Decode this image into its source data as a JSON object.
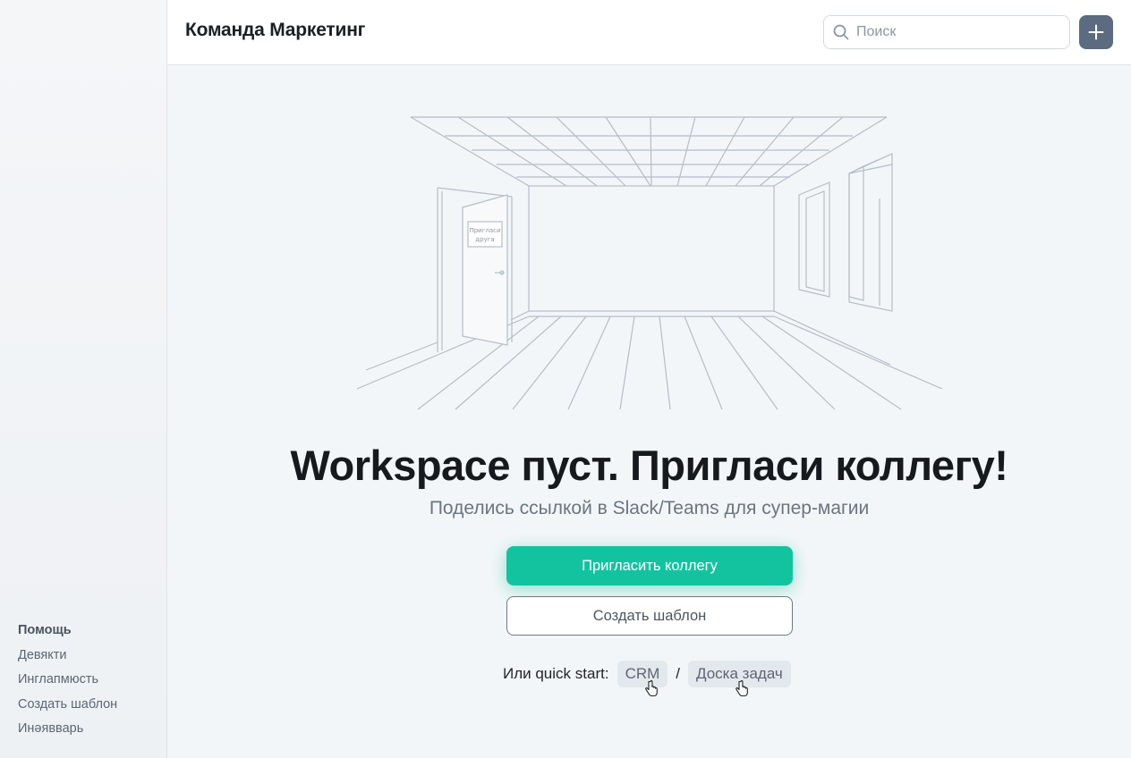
{
  "header": {
    "title": "Команда Маркетинг",
    "search_placeholder": "Поиск",
    "add_icon": "plus-icon"
  },
  "sidebar": {
    "footer_items": [
      {
        "label": "Помощь"
      },
      {
        "label": "Девякти"
      },
      {
        "label": "Инглапмюсть"
      },
      {
        "label": "Создать шаблон"
      },
      {
        "label": "Инәявварь"
      }
    ]
  },
  "empty_state": {
    "illustration": "empty-room-illustration",
    "door_sign": [
      "Пригласи",
      "друга"
    ],
    "headline": "Workspace пуст. Пригласи коллегу!",
    "subline": "Поделись ссылкой в Slack/Teams для супер-магии",
    "primary_button": "Пригласить коллегу",
    "secondary_button": "Создать шаблон",
    "quickstart_label": "Или quick start:",
    "quickstart_options": [
      "CRM",
      "Доска задач"
    ],
    "quickstart_separator": "/"
  },
  "colors": {
    "accent": "#13c3a0",
    "add_button": "#5c6b80",
    "background": "#f3f6f8"
  }
}
